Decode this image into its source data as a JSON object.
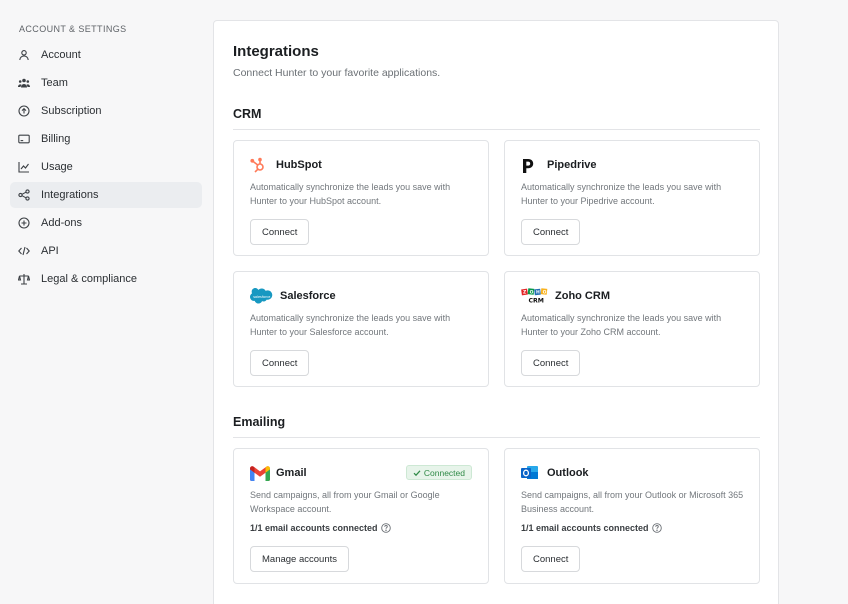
{
  "sidebar": {
    "heading": "ACCOUNT & SETTINGS",
    "items": [
      {
        "label": "Account",
        "icon": "user-icon"
      },
      {
        "label": "Team",
        "icon": "team-icon"
      },
      {
        "label": "Subscription",
        "icon": "subscription-icon"
      },
      {
        "label": "Billing",
        "icon": "billing-icon"
      },
      {
        "label": "Usage",
        "icon": "usage-chart-icon"
      },
      {
        "label": "Integrations",
        "icon": "integrations-icon",
        "active": true
      },
      {
        "label": "Add-ons",
        "icon": "add-ons-icon"
      },
      {
        "label": "API",
        "icon": "code-icon"
      },
      {
        "label": "Legal & compliance",
        "icon": "scale-icon"
      }
    ]
  },
  "main": {
    "title": "Integrations",
    "subtitle": "Connect Hunter to your favorite applications.",
    "sections": {
      "crm": {
        "title": "CRM",
        "cards": [
          {
            "name": "HubSpot",
            "icon": "hubspot-logo",
            "description": "Automatically synchronize the leads you save with Hunter to your HubSpot account.",
            "button": "Connect"
          },
          {
            "name": "Pipedrive",
            "icon": "pipedrive-logo",
            "description": "Automatically synchronize the leads you save with Hunter to your Pipedrive account.",
            "button": "Connect"
          },
          {
            "name": "Salesforce",
            "icon": "salesforce-logo",
            "description": "Automatically synchronize the leads you save with Hunter to your Salesforce account.",
            "button": "Connect"
          },
          {
            "name": "Zoho CRM",
            "icon": "zoho-logo",
            "description": "Automatically synchronize the leads you save with Hunter to your Zoho CRM account.",
            "button": "Connect"
          }
        ]
      },
      "emailing": {
        "title": "Emailing",
        "cards": [
          {
            "name": "Gmail",
            "icon": "gmail-logo",
            "badge": "Connected",
            "description": "Send campaigns, all from your Gmail or Google Workspace account.",
            "status": "1/1 email accounts connected",
            "button": "Manage accounts"
          },
          {
            "name": "Outlook",
            "icon": "outlook-logo",
            "description": "Send campaigns, all from your Outlook or Microsoft 365 Business account.",
            "status": "1/1 email accounts connected",
            "button": "Connect"
          }
        ]
      }
    }
  },
  "colors": {
    "hubspot": "#ff7a59",
    "salesforce": "#1798c1",
    "gmail_red": "#ea4335",
    "outlook_blue": "#0a64c8",
    "connected_green": "#2f8a47"
  }
}
